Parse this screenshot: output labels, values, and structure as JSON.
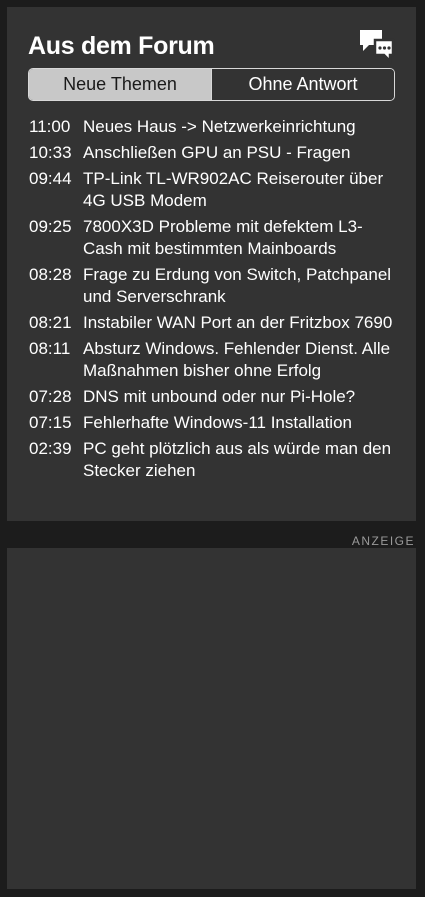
{
  "widget": {
    "title": "Aus dem Forum",
    "icon": "forum-chat-bubbles-icon",
    "tabs": [
      {
        "label": "Neue Themen",
        "active": true
      },
      {
        "label": "Ohne Antwort",
        "active": false
      }
    ],
    "topics": [
      {
        "time": "11:00",
        "title": "Neues Haus -> Netzwerkeinrichtung"
      },
      {
        "time": "10:33",
        "title": "Anschließen GPU an PSU - Fragen"
      },
      {
        "time": "09:44",
        "title": "TP-Link TL-WR902AC Reiserouter über 4G USB Modem"
      },
      {
        "time": "09:25",
        "title": "7800X3D Probleme mit defektem L3-Cash mit bestimmten Mainboards"
      },
      {
        "time": "08:28",
        "title": "Frage zu Erdung von Switch, Patchpanel und Serverschrank"
      },
      {
        "time": "08:21",
        "title": "Instabiler WAN Port an der Fritzbox 7690"
      },
      {
        "time": "08:11",
        "title": "Absturz Windows. Fehlender Dienst. Alle Maßnahmen bisher ohne Erfolg"
      },
      {
        "time": "07:28",
        "title": "DNS mit unbound oder nur Pi-Hole?"
      },
      {
        "time": "07:15",
        "title": "Fehlerhafte Windows-11 Installation"
      },
      {
        "time": "02:39",
        "title": "PC geht plötzlich aus als würde man den Stecker ziehen"
      }
    ]
  },
  "ad": {
    "label": "ANZEIGE"
  },
  "colors": {
    "page_bg": "#1c1c1c",
    "panel_bg": "#333333",
    "active_tab_bg": "#c8c8c8",
    "ad_label": "#9a9a9a"
  }
}
